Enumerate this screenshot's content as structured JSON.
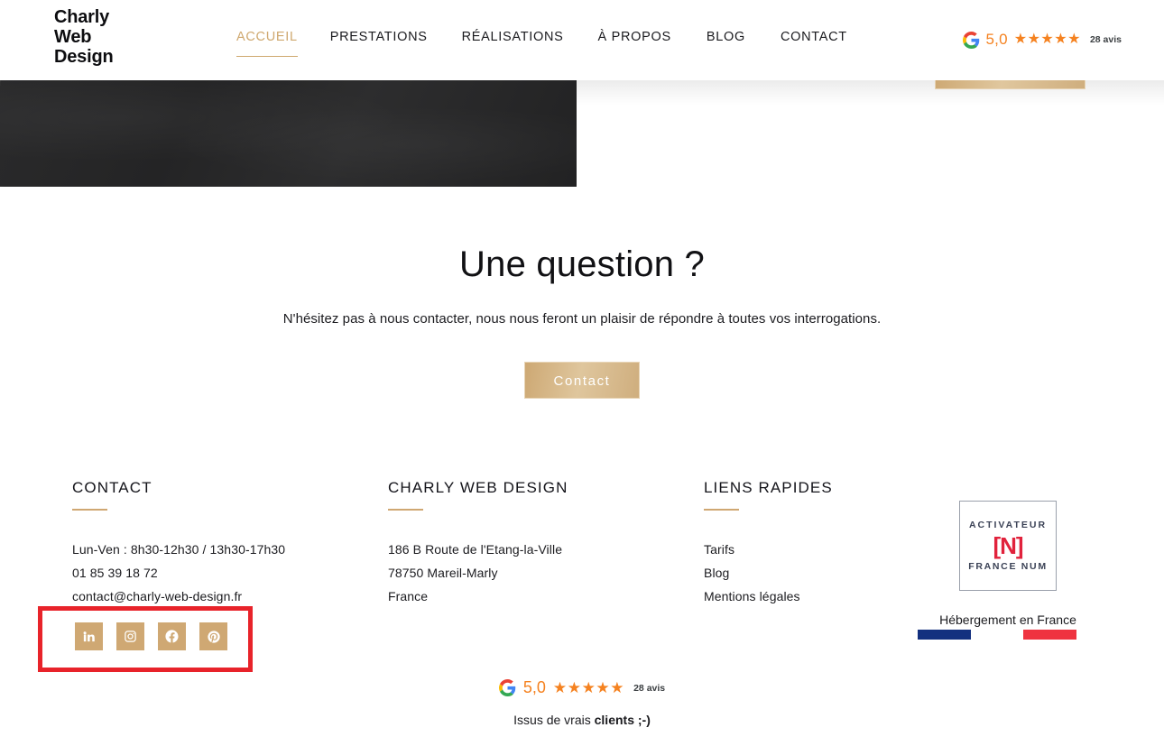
{
  "header": {
    "logo_lines": [
      "Charly",
      "Web",
      "Design"
    ],
    "nav": [
      {
        "label": "ACCUEIL",
        "active": true
      },
      {
        "label": "PRESTATIONS",
        "active": false
      },
      {
        "label": "RÉALISATIONS",
        "active": false
      },
      {
        "label": "À PROPOS",
        "active": false
      },
      {
        "label": "BLOG",
        "active": false
      },
      {
        "label": "CONTACT",
        "active": false
      }
    ],
    "google_review": {
      "icon": "google-g-icon",
      "score": "5,0",
      "stars": "★★★★★",
      "count": "28 avis"
    }
  },
  "hero": {
    "dark_panel": "dark-textured-image",
    "floating_button": ""
  },
  "question_section": {
    "title": "Une question ?",
    "subtitle": "N'hésitez pas à nous contacter, nous nous feront un plaisir de répondre à toutes vos interrogations.",
    "button_label": "Contact"
  },
  "footer": {
    "contact": {
      "title": "CONTACT",
      "hours": "Lun-Ven : 8h30-12h30 / 13h30-17h30",
      "phone": "01 85 39 18 72",
      "email": "contact@charly-web-design.fr",
      "social": [
        {
          "name": "linkedin-icon",
          "label": "LinkedIn"
        },
        {
          "name": "instagram-icon",
          "label": "Instagram"
        },
        {
          "name": "facebook-icon",
          "label": "Facebook"
        },
        {
          "name": "pinterest-icon",
          "label": "Pinterest"
        }
      ]
    },
    "brand": {
      "title": "CHARLY WEB DESIGN",
      "address_1": "186 B Route de l'Etang-la-Ville",
      "address_2": "78750 Mareil-Marly",
      "address_3": "France"
    },
    "links": {
      "title": "LIENS RAPIDES",
      "items": [
        "Tarifs",
        "Blog",
        "Mentions légales"
      ]
    },
    "badge": {
      "top_text": "ACTIVATEUR",
      "mark": "[N]",
      "bottom_text": "FRANCE NUM",
      "hosting_text": "Hébergement en France"
    }
  },
  "bottom_reviews": {
    "icon": "google-g-icon",
    "score": "5,0",
    "stars": "★★★★★",
    "count": "28 avis",
    "tagline_prefix": "Issus de vrais ",
    "tagline_bold": "clients ;-)"
  },
  "colors": {
    "accent_tan": "#cfa873",
    "star_orange": "#f58220",
    "annotation_red": "#e8232a",
    "text_dark": "#1b1b1f"
  }
}
